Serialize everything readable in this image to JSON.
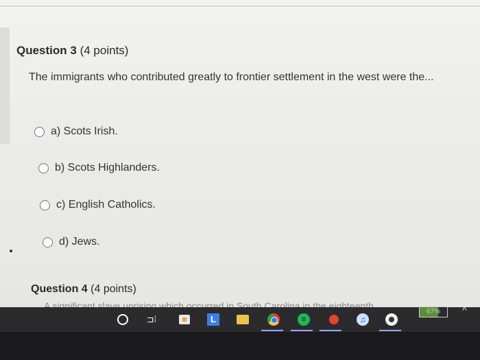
{
  "question3": {
    "title": "Question 3",
    "points": "(4 points)",
    "text": "The immigrants who contributed greatly to frontier settlement in the west were the...",
    "options": [
      {
        "label": "a) Scots Irish."
      },
      {
        "label": "b) Scots Highlanders."
      },
      {
        "label": "c) English Catholics."
      },
      {
        "label": "d) Jews."
      }
    ]
  },
  "question4": {
    "title": "Question 4",
    "points": "(4 points)",
    "partial_text": "A significant slave uprising which occurred in South Carolina in the eighteenth"
  },
  "taskbar": {
    "icons": [
      "search-icon",
      "task-view-icon",
      "store-icon",
      "l-app-icon",
      "folder-icon",
      "chrome-icon",
      "spotify-icon",
      "red-circle-app-icon",
      "music-icon",
      "disc-app-icon"
    ],
    "battery": "67%",
    "battery_level": 0.67,
    "task_view_glyph": "⊐⁞",
    "l_app_letter": "L",
    "spotify_glyph": "≡",
    "music_glyph": "♫",
    "chevron": "^"
  }
}
